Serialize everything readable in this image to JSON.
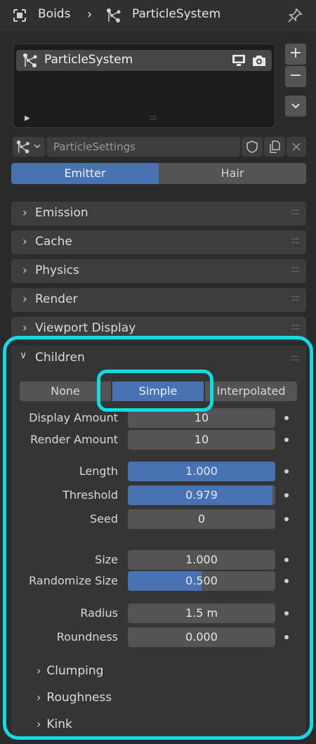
{
  "header": {
    "breadcrumb": [
      "Boids",
      "ParticleSystem"
    ]
  },
  "particle_list": {
    "items": [
      {
        "name": "ParticleSystem"
      }
    ],
    "add_label": "+",
    "remove_label": "−"
  },
  "settings": {
    "name": "ParticleSettings"
  },
  "type_tabs": [
    {
      "label": "Emitter",
      "active": true
    },
    {
      "label": "Hair",
      "active": false
    }
  ],
  "panels": [
    {
      "label": "Emission"
    },
    {
      "label": "Cache"
    },
    {
      "label": "Physics"
    },
    {
      "label": "Render"
    },
    {
      "label": "Viewport Display"
    }
  ],
  "children": {
    "label": "Children",
    "modes": [
      {
        "label": "None",
        "active": false
      },
      {
        "label": "Simple",
        "active": true
      },
      {
        "label": "Interpolated",
        "active": false
      }
    ],
    "props": [
      {
        "label": "Display Amount",
        "value": "10",
        "fill": 0
      },
      {
        "label": "Render Amount",
        "value": "10",
        "fill": 0
      },
      {
        "label": "Length",
        "value": "1.000",
        "fill": 1.0
      },
      {
        "label": "Threshold",
        "value": "0.979",
        "fill": 0.979
      },
      {
        "label": "Seed",
        "value": "0",
        "fill": 0
      },
      {
        "label": "Size",
        "value": "1.000",
        "fill": 0
      },
      {
        "label": "Randomize Size",
        "value": "0.500",
        "fill": 0.5
      },
      {
        "label": "Radius",
        "value": "1.5 m",
        "fill": 0
      },
      {
        "label": "Roundness",
        "value": "0.000",
        "fill": 0
      }
    ],
    "subpanels": [
      {
        "label": "Clumping"
      },
      {
        "label": "Roughness"
      },
      {
        "label": "Kink"
      }
    ]
  },
  "colors": {
    "accent": "#4772b3",
    "highlight": "#16d9e6",
    "background": "#2b2b2b"
  }
}
